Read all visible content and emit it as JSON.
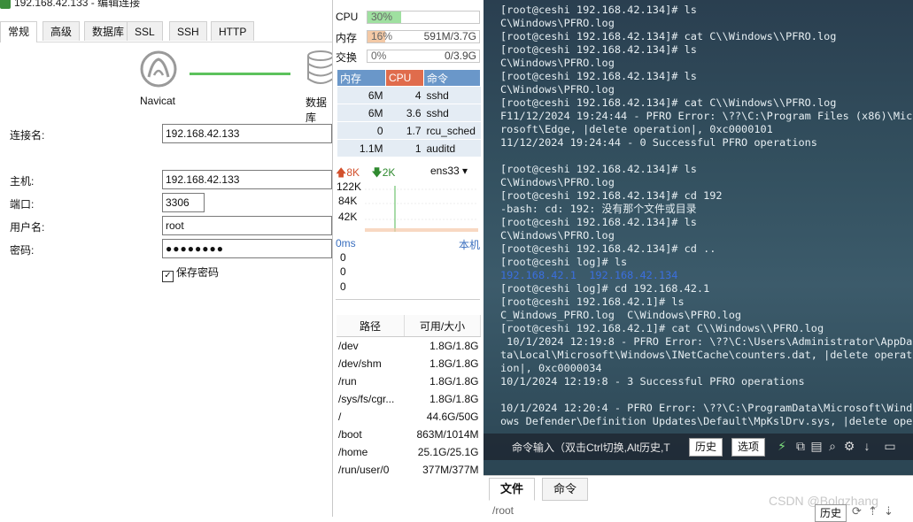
{
  "dialog": {
    "title": "192.168.42.133 - 编辑连接",
    "tabs": [
      "常规",
      "高级",
      "数据库",
      "SSL",
      "SSH",
      "HTTP"
    ],
    "graphic": {
      "client_label": "Navicat",
      "server_label": "数据库"
    },
    "labels": {
      "conn_name": "连接名:",
      "host": "主机:",
      "port": "端口:",
      "user": "用户名:",
      "password": "密码:"
    },
    "values": {
      "conn_name": "192.168.42.133",
      "host": "192.168.42.133",
      "port": "3306",
      "user": "root",
      "password": "●●●●●●●●"
    },
    "save_password": "保存密码",
    "save_password_checked": true
  },
  "monitor": {
    "cpu": {
      "label": "CPU",
      "percent": "30%",
      "fraction": 0.3
    },
    "mem": {
      "label": "内存",
      "percent": "16%",
      "amount": "591M/3.7G",
      "fraction": 0.16
    },
    "swap": {
      "label": "交换",
      "percent": "0%",
      "amount": "0/3.9G",
      "fraction": 0.0
    },
    "proc_headers": [
      "内存",
      "CPU",
      "命令"
    ],
    "processes": [
      {
        "mem": "6M",
        "cpu": "4",
        "cmd": "sshd"
      },
      {
        "mem": "6M",
        "cpu": "3.6",
        "cmd": "sshd"
      },
      {
        "mem": "0",
        "cpu": "1.7",
        "cmd": "rcu_sched"
      },
      {
        "mem": "1.1M",
        "cpu": "1",
        "cmd": "auditd"
      }
    ],
    "net": {
      "up": "8K",
      "down": "2K",
      "iface": "ens33",
      "ticks": [
        "122K",
        "84K",
        "42K"
      ]
    },
    "latency": {
      "value": "0ms",
      "host": "本机",
      "rows": [
        "0",
        "0",
        "0"
      ]
    },
    "disk_headers": [
      "路径",
      "可用/大小"
    ],
    "disks": [
      {
        "path": "/dev",
        "size": "1.8G/1.8G"
      },
      {
        "path": "/dev/shm",
        "size": "1.8G/1.8G"
      },
      {
        "path": "/run",
        "size": "1.8G/1.8G"
      },
      {
        "path": "/sys/fs/cgr...",
        "size": "1.8G/1.8G"
      },
      {
        "path": "/",
        "size": "44.6G/50G"
      },
      {
        "path": "/boot",
        "size": "863M/1014M"
      },
      {
        "path": "/home",
        "size": "25.1G/25.1G"
      },
      {
        "path": "/run/user/0",
        "size": "377M/377M"
      }
    ],
    "colors": {
      "cpu_fill": "#9fe0a0",
      "mem_fill": "#f3c9a6",
      "proc_mem_header": "#6a97c9",
      "proc_cpu_header": "#e06c4c"
    }
  },
  "terminal": {
    "lines": [
      "[root@ceshi 192.168.42.134]# ls",
      "C\\Windows\\PFRO.log",
      "[root@ceshi 192.168.42.134]# cat C\\\\Windows\\\\PFRO.log",
      "[root@ceshi 192.168.42.134]# ls",
      "C\\Windows\\PFRO.log",
      "[root@ceshi 192.168.42.134]# ls",
      "C\\Windows\\PFRO.log",
      "[root@ceshi 192.168.42.134]# cat C\\\\Windows\\\\PFRO.log",
      "F11/12/2024 19:24:44 - PFRO Error: \\??\\C:\\Program Files (x86)\\Mic",
      "rosoft\\Edge, |delete operation|, 0xc0000101",
      "11/12/2024 19:24:44 - 0 Successful PFRO operations",
      "",
      "[root@ceshi 192.168.42.134]# ls",
      "C\\Windows\\PFRO.log",
      "[root@ceshi 192.168.42.134]# cd 192",
      "-bash: cd: 192: 没有那个文件或目录",
      "[root@ceshi 192.168.42.134]# ls",
      "C\\Windows\\PFRO.log",
      "[root@ceshi 192.168.42.134]# cd ..",
      "[root@ceshi log]# ls",
      "192.168.42.1  192.168.42.134",
      "[root@ceshi log]# cd 192.168.42.1",
      "[root@ceshi 192.168.42.1]# ls",
      "C_Windows_PFRO.log  C\\Windows\\PFRO.log",
      "[root@ceshi 192.168.42.1]# cat C\\\\Windows\\\\PFRO.log",
      " 10/1/2024 12:19:8 - PFRO Error: \\??\\C:\\Users\\Administrator\\AppDa",
      "ta\\Local\\Microsoft\\Windows\\INetCache\\counters.dat, |delete operat",
      "ion|, 0xc0000034",
      "10/1/2024 12:19:8 - 3 Successful PFRO operations",
      "",
      "10/1/2024 12:20:4 - PFRO Error: \\??\\C:\\ProgramData\\Microsoft\\Wind",
      "ows Defender\\Definition Updates\\Default\\MpKslDrv.sys, |delete ope"
    ],
    "highlight_line_index": 20,
    "cmd_input_label": "命令输入（双击Ctrl切换,Alt历史,T",
    "history_button": "历史",
    "options_button": "选项"
  },
  "bottom": {
    "tabs": [
      "文件",
      "命令"
    ],
    "path": "/root",
    "history_button": "历史",
    "watermark": "CSDN @Bolgzhang"
  }
}
